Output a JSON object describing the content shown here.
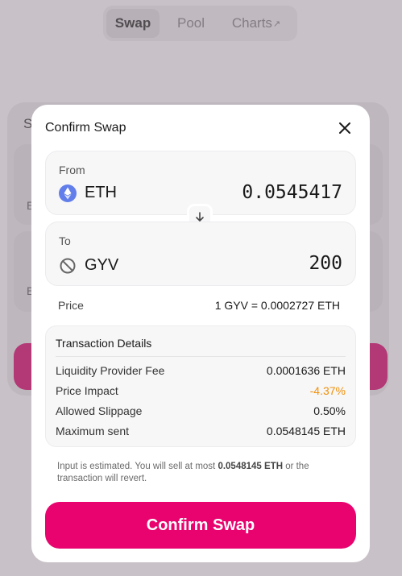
{
  "nav": {
    "tabs": [
      {
        "label": "Swap"
      },
      {
        "label": "Pool"
      },
      {
        "label": "Charts",
        "external_mark": "↗"
      }
    ]
  },
  "background": {
    "card_title_initial": "S",
    "balance_initial_1": "E",
    "balance_initial_2": "E"
  },
  "modal": {
    "title": "Confirm Swap",
    "from": {
      "label": "From",
      "symbol": "ETH",
      "amount": "0.0545417",
      "icon": "ethereum-icon"
    },
    "to": {
      "label": "To",
      "symbol": "GYV",
      "amount": "200",
      "icon": "unknown-token-icon"
    },
    "price": {
      "label": "Price",
      "value": "1 GYV = 0.0002727 ETH"
    },
    "details": {
      "title": "Transaction Details",
      "rows": [
        {
          "label": "Liquidity Provider Fee",
          "value": "0.0001636 ETH"
        },
        {
          "label": "Price Impact",
          "value": "-4.37%"
        },
        {
          "label": "Allowed Slippage",
          "value": "0.50%"
        },
        {
          "label": "Maximum sent",
          "value": "0.0548145 ETH"
        }
      ]
    },
    "note": {
      "prefix": "Input is estimated. You will sell at most ",
      "amount": "0.0548145 ETH",
      "suffix": " or the transaction will revert."
    },
    "confirm_label": "Confirm Swap"
  },
  "colors": {
    "accent": "#e8036e",
    "warning": "#f0900c",
    "eth": "#627eea"
  }
}
